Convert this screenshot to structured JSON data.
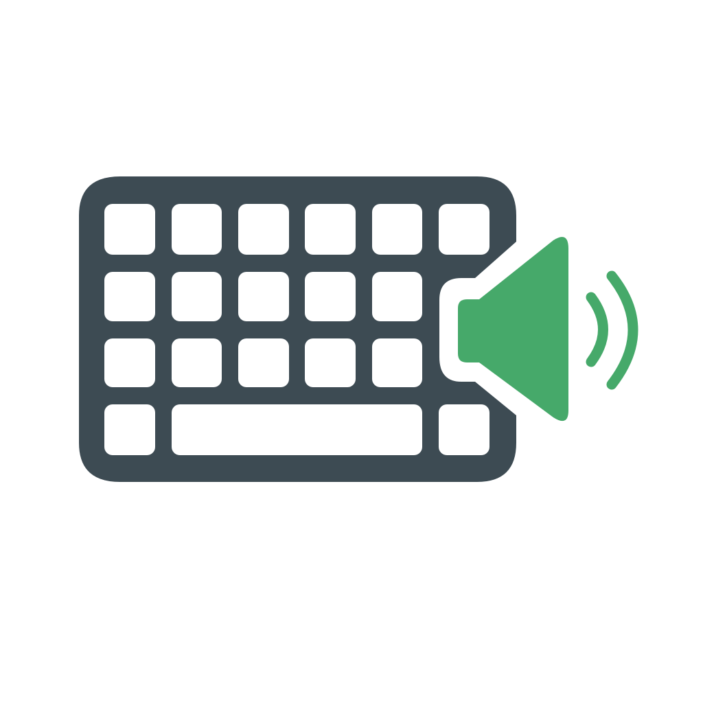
{
  "icon": {
    "name": "keyboard-with-speaker",
    "parts": [
      "keyboard-icon",
      "speaker-icon",
      "sound-waves-icon"
    ],
    "keyboard_rows": 4,
    "keys_per_row": [
      6,
      5,
      5,
      3
    ],
    "colors": {
      "background": "#ffffff",
      "keyboard_body": "#3d4b53",
      "keys": "#ffffff",
      "speaker": "#46a96a"
    }
  }
}
